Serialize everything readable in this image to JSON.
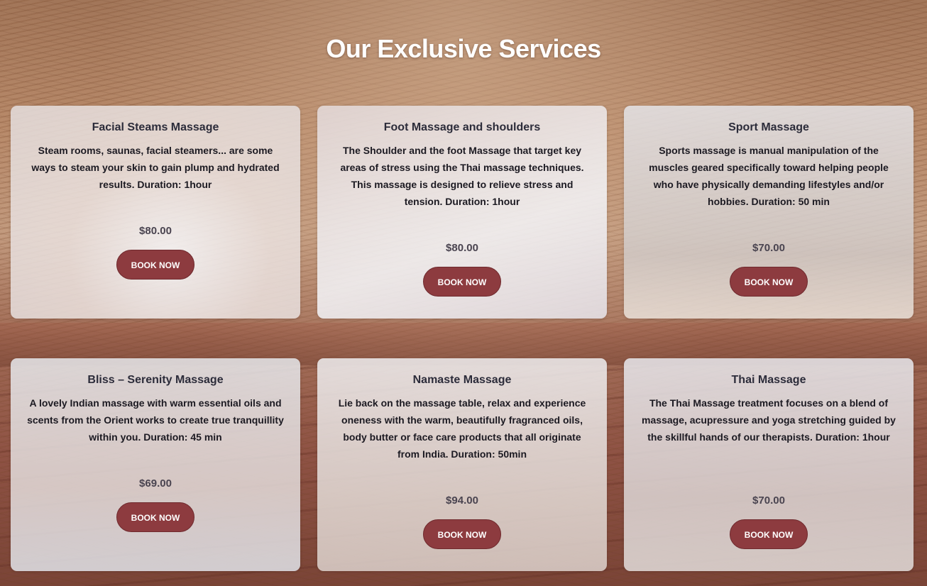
{
  "page": {
    "title": "Our Exclusive Services"
  },
  "colors": {
    "button": "#8d3b3f",
    "button_text": "#ffffff",
    "card_bg": "#ececf0"
  },
  "services": [
    {
      "name": "Facial Steams Massage",
      "description": "Steam rooms, saunas, facial steamers... are some ways to steam your skin to gain plump and hydrated results. Duration: 1hour",
      "price": "$80.00",
      "button": "BOOK NOW"
    },
    {
      "name": "Foot Massage and shoulders",
      "description": "The Shoulder and the foot Massage that target key areas of stress using the Thai massage techniques. This massage is designed to relieve stress and tension. Duration: 1hour",
      "price": "$80.00",
      "button": "BOOK NOW"
    },
    {
      "name": "Sport Massage",
      "description": "Sports massage is manual manipulation of the muscles geared specifically toward helping people who have physically demanding lifestyles and/or hobbies. Duration: 50 min",
      "price": "$70.00",
      "button": "BOOK NOW"
    },
    {
      "name": "Bliss – Serenity Massage",
      "description": "A lovely Indian massage with warm essential oils and scents from the Orient works to create true tranquillity within you. Duration: 45 min",
      "price": "$69.00",
      "button": "BOOK NOW"
    },
    {
      "name": "Namaste Massage",
      "description": "Lie back on the massage table, relax and experience oneness with the warm, beautifully fragranced oils, body butter or face care products that all originate from India. Duration: 50min",
      "price": "$94.00",
      "button": "BOOK NOW"
    },
    {
      "name": "Thai Massage",
      "description": "The Thai Massage treatment focuses on a blend of massage, acupressure and yoga stretching guided by the skillful hands of our therapists. Duration: 1hour",
      "price": "$70.00",
      "button": "BOOK NOW"
    }
  ]
}
